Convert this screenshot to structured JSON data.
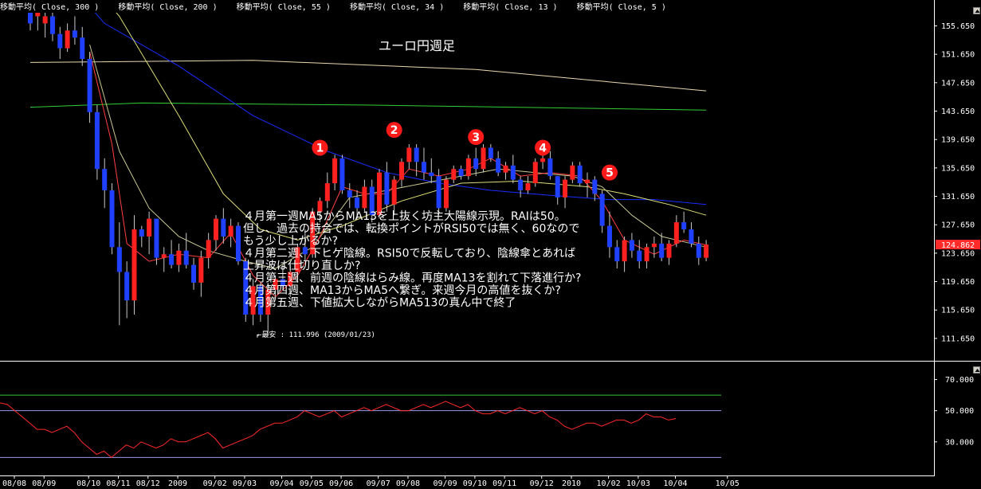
{
  "legend": [
    "移動平均( Close, 300 )",
    "移動平均( Close, 200 )",
    "移動平均( Close, 55 )",
    "移動平均( Close, 34 )",
    "移動平均( Close, 13 )",
    "移動平均( Close, 5 )"
  ],
  "colors": {
    "background": "#000000",
    "bullish": "#ff2020",
    "bearish": "#2040ff",
    "ma5": "#ff4040",
    "ma13": "#c8c890",
    "ma34": "#dddd77",
    "ma55": "#1a2dff",
    "ma200": "#33cc33",
    "ma300": "#e8d8b0",
    "rsi": "#ff2a2a",
    "rsi_upper_line": "#33cc33",
    "rsi_lower_line": "#9999ee",
    "price_label_bg": "#ff2a2a"
  },
  "chart_data": [
    {
      "type": "candlestick",
      "title": "ユーロ円週足",
      "ylim": [
        108.5,
        157.5
      ],
      "y_ticks": [
        "155.650",
        "151.650",
        "147.650",
        "143.650",
        "139.650",
        "135.650",
        "131.650",
        "127.650",
        "123.650",
        "119.650",
        "115.650",
        "111.650"
      ],
      "y_tick_values": [
        155.65,
        151.65,
        147.65,
        143.65,
        139.65,
        135.65,
        131.65,
        127.65,
        123.65,
        119.65,
        115.65,
        111.65
      ],
      "current_price": "124.862",
      "current_price_value": 124.862,
      "x_ticks": [
        "08/08",
        "08/09",
        "08/10",
        "08/11",
        "08/12",
        "2009",
        "09/02",
        "09/03",
        "09/04",
        "09/05",
        "09/06",
        "09/07",
        "09/08",
        "09/09",
        "09/10",
        "09/11",
        "09/12",
        "2010",
        "10/02",
        "10/03",
        "10/04",
        "10/05"
      ],
      "x_tick_index": [
        0,
        4,
        10,
        14,
        18,
        22,
        27,
        31,
        36,
        40,
        44,
        49,
        53,
        58,
        62,
        66,
        71,
        75,
        80,
        84,
        89,
        96
      ],
      "ohlc": [
        [
          158.5,
          159.0,
          155.0,
          156.0
        ],
        [
          157.0,
          160.0,
          155.0,
          158.5
        ],
        [
          156.0,
          159.0,
          154.0,
          157.0
        ],
        [
          157.0,
          158.5,
          153.5,
          154.5
        ],
        [
          154.5,
          155.5,
          151.0,
          152.5
        ],
        [
          152.5,
          156.0,
          152.0,
          155.0
        ],
        [
          155.0,
          157.0,
          153.0,
          154.0
        ],
        [
          154.0,
          155.5,
          150.0,
          151.0
        ],
        [
          151.0,
          152.0,
          142.0,
          143.5
        ],
        [
          143.5,
          144.5,
          134.0,
          135.5
        ],
        [
          135.5,
          137.0,
          130.0,
          132.5
        ],
        [
          132.5,
          133.5,
          123.5,
          124.5
        ],
        [
          124.5,
          128.0,
          113.5,
          121.0
        ],
        [
          121.0,
          122.5,
          114.5,
          117.0
        ],
        [
          117.0,
          129.0,
          115.0,
          127.0
        ],
        [
          127.0,
          127.5,
          124.5,
          126.0
        ],
        [
          126.0,
          129.5,
          123.5,
          128.5
        ],
        [
          128.5,
          128.5,
          122.0,
          123.0
        ],
        [
          123.0,
          124.5,
          121.0,
          123.5
        ],
        [
          123.5,
          125.5,
          121.5,
          122.0
        ],
        [
          122.0,
          125.0,
          121.0,
          124.0
        ],
        [
          124.0,
          126.5,
          121.5,
          122.0
        ],
        [
          122.0,
          123.0,
          118.5,
          119.5
        ],
        [
          119.5,
          124.0,
          117.5,
          123.0
        ],
        [
          123.0,
          126.5,
          121.5,
          125.5
        ],
        [
          125.5,
          129.0,
          124.0,
          128.5
        ],
        [
          128.5,
          130.0,
          125.0,
          126.0
        ],
        [
          126.0,
          128.5,
          124.5,
          127.5
        ],
        [
          127.5,
          128.0,
          122.0,
          122.5
        ],
        [
          122.5,
          123.0,
          114.0,
          115.0
        ],
        [
          115.0,
          120.0,
          113.5,
          119.0
        ],
        [
          119.0,
          119.5,
          114.0,
          115.0
        ],
        [
          115.0,
          119.5,
          112.0,
          118.5
        ],
        [
          118.5,
          120.5,
          117.0,
          120.0
        ],
        [
          120.0,
          122.0,
          118.5,
          119.0
        ],
        [
          119.0,
          122.0,
          117.5,
          121.0
        ],
        [
          121.0,
          125.0,
          119.5,
          124.5
        ],
        [
          124.5,
          127.0,
          122.5,
          123.5
        ],
        [
          123.5,
          130.0,
          123.0,
          129.5
        ],
        [
          129.5,
          131.5,
          128.0,
          131.0
        ],
        [
          131.0,
          135.0,
          130.0,
          133.5
        ],
        [
          133.5,
          137.5,
          132.5,
          137.0
        ],
        [
          137.0,
          137.5,
          132.0,
          132.5
        ],
        [
          132.5,
          133.5,
          130.0,
          131.5
        ],
        [
          131.5,
          132.5,
          128.5,
          130.0
        ],
        [
          130.0,
          134.0,
          129.5,
          133.0
        ],
        [
          133.0,
          134.0,
          128.0,
          129.0
        ],
        [
          129.0,
          135.5,
          128.5,
          135.0
        ],
        [
          135.0,
          136.5,
          129.5,
          130.5
        ],
        [
          130.5,
          134.5,
          129.0,
          134.0
        ],
        [
          134.0,
          137.0,
          133.0,
          136.5
        ],
        [
          136.5,
          139.0,
          135.5,
          138.5
        ],
        [
          138.5,
          139.0,
          134.5,
          136.5
        ],
        [
          136.5,
          138.5,
          134.0,
          135.0
        ],
        [
          135.0,
          137.0,
          133.5,
          134.5
        ],
        [
          134.5,
          135.5,
          129.0,
          130.0
        ],
        [
          130.0,
          134.5,
          129.5,
          134.0
        ],
        [
          134.0,
          136.0,
          133.5,
          135.5
        ],
        [
          135.5,
          136.0,
          134.0,
          134.5
        ],
        [
          134.5,
          137.5,
          134.0,
          137.0
        ],
        [
          137.0,
          138.5,
          134.5,
          135.5
        ],
        [
          135.5,
          139.0,
          135.0,
          138.5
        ],
        [
          138.5,
          139.0,
          136.5,
          137.0
        ],
        [
          137.0,
          138.0,
          134.5,
          135.0
        ],
        [
          135.0,
          136.5,
          134.0,
          136.0
        ],
        [
          136.0,
          137.5,
          133.5,
          134.0
        ],
        [
          134.0,
          134.5,
          131.5,
          132.5
        ],
        [
          132.5,
          134.5,
          132.0,
          133.5
        ],
        [
          133.5,
          137.0,
          133.0,
          136.5
        ],
        [
          136.5,
          137.5,
          135.5,
          137.0
        ],
        [
          137.0,
          138.0,
          134.0,
          134.5
        ],
        [
          134.5,
          134.5,
          130.5,
          131.5
        ],
        [
          131.5,
          134.5,
          130.0,
          134.0
        ],
        [
          134.0,
          136.5,
          133.5,
          136.0
        ],
        [
          136.0,
          136.5,
          133.0,
          133.5
        ],
        [
          133.5,
          135.0,
          131.5,
          134.0
        ],
        [
          134.0,
          134.5,
          131.0,
          132.0
        ],
        [
          132.0,
          132.5,
          126.5,
          127.5
        ],
        [
          127.5,
          129.5,
          123.0,
          124.5
        ],
        [
          124.5,
          125.5,
          121.5,
          122.5
        ],
        [
          122.5,
          126.0,
          121.0,
          125.5
        ],
        [
          125.5,
          126.5,
          123.0,
          124.0
        ],
        [
          124.0,
          125.5,
          121.5,
          122.5
        ],
        [
          122.5,
          125.0,
          121.5,
          124.5
        ],
        [
          124.5,
          126.0,
          123.0,
          125.0
        ],
        [
          125.0,
          126.5,
          122.5,
          123.0
        ],
        [
          123.0,
          125.5,
          122.0,
          125.0
        ],
        [
          125.0,
          129.0,
          124.5,
          128.0
        ],
        [
          128.0,
          129.5,
          126.5,
          127.0
        ],
        [
          127.0,
          128.0,
          124.5,
          125.0
        ],
        [
          125.0,
          126.0,
          122.0,
          123.0
        ],
        [
          123.0,
          125.5,
          122.5,
          124.862
        ]
      ],
      "ma_series": [
        {
          "name": "移動平均( Close, 300 )",
          "color": "#e8d8b0",
          "pts": [
            [
              0,
              150.5
            ],
            [
              30,
              150.8
            ],
            [
              60,
              149.5
            ],
            [
              91,
              146.5
            ]
          ]
        },
        {
          "name": "移動平均( Close, 200 )",
          "color": "#33cc33",
          "pts": [
            [
              0,
              144.2
            ],
            [
              15,
              144.8
            ],
            [
              45,
              144.5
            ],
            [
              91,
              143.8
            ]
          ]
        },
        {
          "name": "移動平均( Close, 55 )",
          "color": "#1a2dff",
          "pts": [
            [
              0,
              168.0
            ],
            [
              10,
              156.0
            ],
            [
              20,
              150.0
            ],
            [
              30,
              143.0
            ],
            [
              40,
              138.0
            ],
            [
              48,
              135.0
            ],
            [
              55,
              133.5
            ],
            [
              62,
              132.5
            ],
            [
              70,
              131.8
            ],
            [
              78,
              131.2
            ],
            [
              84,
              131.2
            ],
            [
              91,
              130.5
            ]
          ]
        },
        {
          "name": "移動平均( Close, 34 )",
          "color": "#dddd77",
          "pts": [
            [
              0,
              172.0
            ],
            [
              12,
              157.0
            ],
            [
              20,
              143.0
            ],
            [
              26,
              132.0
            ],
            [
              31,
              127.0
            ],
            [
              36,
              125.5
            ],
            [
              42,
              127.5
            ],
            [
              50,
              131.0
            ],
            [
              58,
              133.5
            ],
            [
              66,
              133.8
            ],
            [
              75,
              133.0
            ],
            [
              80,
              132.0
            ],
            [
              86,
              130.5
            ],
            [
              91,
              129.0
            ]
          ]
        },
        {
          "name": "移動平均( Close, 13 )",
          "color": "#c8c890",
          "pts": [
            [
              8,
              153.0
            ],
            [
              12,
              138.0
            ],
            [
              16,
              130.0
            ],
            [
              20,
              126.0
            ],
            [
              24,
              124.0
            ],
            [
              29,
              122.5
            ],
            [
              33,
              121.5
            ],
            [
              38,
              124.5
            ],
            [
              43,
              131.5
            ],
            [
              48,
              132.5
            ],
            [
              53,
              133.5
            ],
            [
              58,
              134.5
            ],
            [
              63,
              135.5
            ],
            [
              68,
              135.0
            ],
            [
              73,
              134.5
            ],
            [
              77,
              133.0
            ],
            [
              81,
              129.0
            ],
            [
              85,
              126.0
            ],
            [
              91,
              124.5
            ]
          ]
        },
        {
          "name": "移動平均( Close, 5 )",
          "color": "#ff4040",
          "pts": [
            [
              8,
              152.0
            ],
            [
              11,
              139.0
            ],
            [
              13,
              125.0
            ],
            [
              16,
              122.5
            ],
            [
              20,
              123.5
            ],
            [
              24,
              123.0
            ],
            [
              27,
              126.5
            ],
            [
              30,
              120.5
            ],
            [
              33,
              117.5
            ],
            [
              36,
              120.5
            ],
            [
              39,
              126.0
            ],
            [
              42,
              133.0
            ],
            [
              45,
              132.0
            ],
            [
              48,
              132.0
            ],
            [
              51,
              135.5
            ],
            [
              55,
              134.5
            ],
            [
              59,
              135.5
            ],
            [
              62,
              137.0
            ],
            [
              66,
              134.5
            ],
            [
              70,
              135.0
            ],
            [
              74,
              134.5
            ],
            [
              77,
              131.0
            ],
            [
              80,
              125.5
            ],
            [
              84,
              123.5
            ],
            [
              88,
              125.5
            ],
            [
              91,
              124.8
            ]
          ]
        }
      ],
      "min_annotation": {
        "text": "最安 : 111.996 (2009/01/23)",
        "index": 31,
        "value": 111.996
      },
      "markers": [
        {
          "label": "1",
          "index": 39,
          "value": 138.5
        },
        {
          "label": "2",
          "index": 49,
          "value": 141.0
        },
        {
          "label": "3",
          "index": 60,
          "value": 140.0
        },
        {
          "label": "4",
          "index": 69,
          "value": 138.5
        },
        {
          "label": "5",
          "index": 78,
          "value": 135.0
        }
      ]
    },
    {
      "type": "line",
      "name": "RSI",
      "ylim": [
        12,
        80
      ],
      "y_ticks": [
        "70.000",
        "50.000",
        "30.000"
      ],
      "y_tick_values": [
        70,
        50,
        30
      ],
      "ref_lines": [
        60,
        50,
        20
      ],
      "values": [
        55,
        54,
        50,
        46,
        42,
        38,
        38,
        36,
        38,
        40,
        36,
        30,
        26,
        22,
        24,
        20,
        24,
        28,
        26,
        30,
        28,
        26,
        28,
        32,
        30,
        30,
        32,
        34,
        36,
        32,
        26,
        28,
        30,
        32,
        34,
        38,
        40,
        42,
        42,
        44,
        46,
        50,
        48,
        46,
        48,
        50,
        46,
        48,
        50,
        52,
        50,
        52,
        54,
        52,
        50,
        50,
        52,
        54,
        52,
        54,
        56,
        54,
        52,
        54,
        50,
        48,
        48,
        50,
        48,
        50,
        52,
        50,
        48,
        50,
        46,
        44,
        40,
        38,
        40,
        42,
        42,
        40,
        42,
        44,
        44,
        42,
        44,
        48,
        46,
        46,
        44,
        45
      ]
    }
  ],
  "annotation_lines": [
    "４月第一週MA5からMA13を上抜く坊主大陽線示現。RAIは50。",
    "但し、過去の持合では、転換ポイントがRSI50では無く、60なので",
    "もう少し上がるか?",
    "４月第二週、下ヒゲ陰線。RSI50で反転しており、陰線傘とあれば",
    "上昇波は仕切り直しか?",
    "４月第三週、前週の陰線はらみ線。再度MA13を割れて下落進行か?",
    "４月第四週、MA13からMA5へ繋ぎ。来週今月の高値を抜くか?",
    "４月第五週、下値拡大しながらMA513の真ん中で終了"
  ]
}
